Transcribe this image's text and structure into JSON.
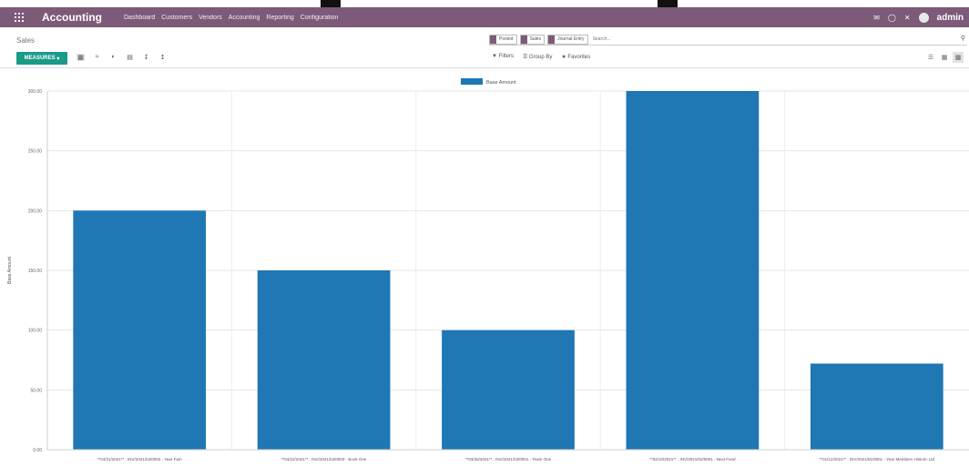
{
  "navbar": {
    "brand": "Accounting",
    "menu": [
      "Dashboard",
      "Customers",
      "Vendors",
      "Accounting",
      "Reporting",
      "Configuration"
    ],
    "user": "admin"
  },
  "breadcrumb": "Sales",
  "search": {
    "facets": [
      "Posted",
      "Sales",
      "Journal Entry"
    ],
    "placeholder": "Search..."
  },
  "measures_label": "MEASURES",
  "filters": {
    "filters": "Filters",
    "groupby": "Group By",
    "favorites": "Favorites"
  },
  "chart_data": {
    "type": "bar",
    "legend": "Base Amount",
    "ylabel": "Base Amount",
    "ylim": [
      0,
      300
    ],
    "yticks": [
      "0.00",
      "50.00",
      "100.00",
      "150.00",
      "200.00",
      "250.00",
      "300.00"
    ],
    "categories": [
      "**04/21/2021** , INV/2021/04/0002 - Year Fam",
      "**04/22/2021** , INV/2021/04/0003 - Book One",
      "**03/26/2021** , INV/2021/03/0001 - Team One",
      "**02/10/2021** , INV/2021/02/0001 - Next Fund",
      "**01/12/2021** , INV/2021/01/0001 - Year Members Historic Ltd"
    ],
    "values": [
      200,
      150,
      100,
      300,
      72
    ],
    "color": "#1f77b4",
    "grid": true
  }
}
